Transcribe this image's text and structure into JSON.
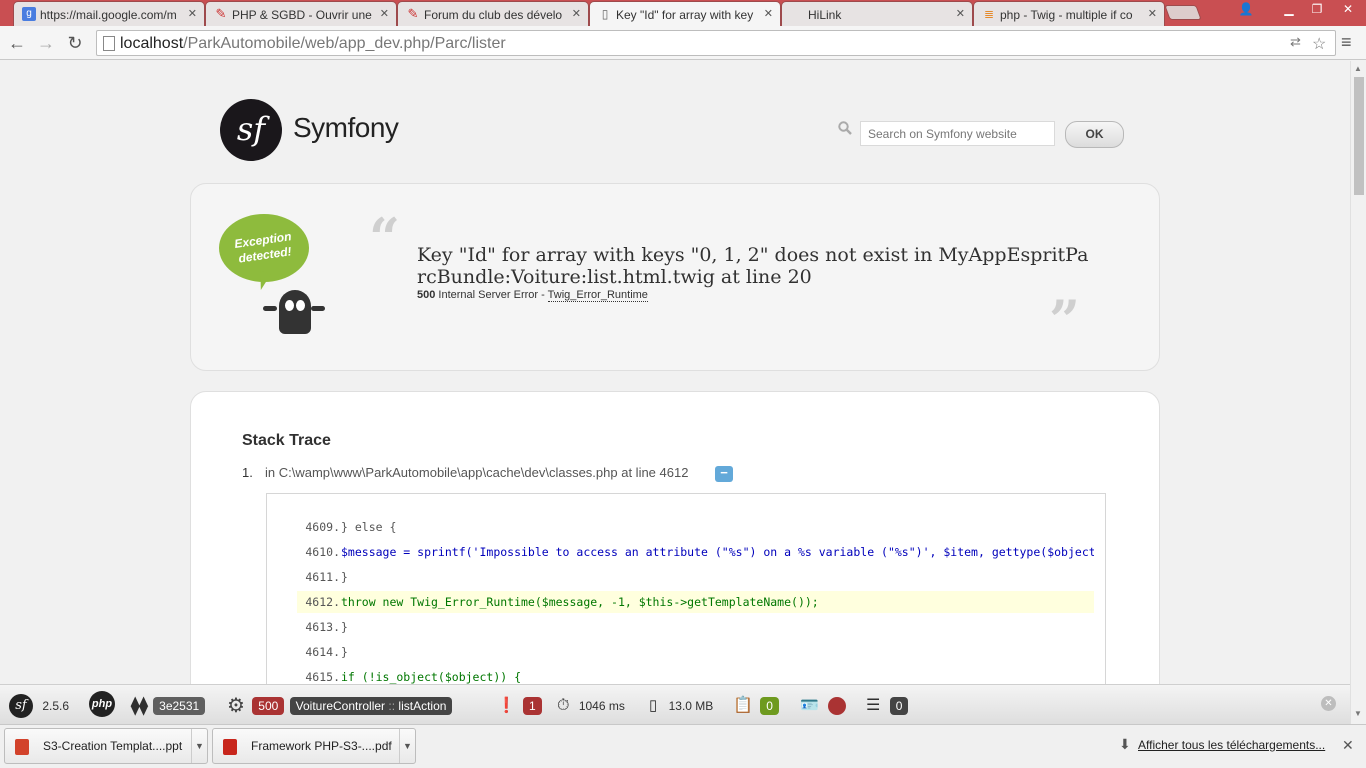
{
  "browser": {
    "tabs": [
      {
        "title": "https://mail.google.com/m",
        "icon": "google-icon",
        "color": "#4a7de0"
      },
      {
        "title": "PHP & SGBD - Ouvrir une",
        "icon": "forum-icon",
        "color": "#c33"
      },
      {
        "title": "Forum du club des dévelo",
        "icon": "forum-icon",
        "color": "#c33"
      },
      {
        "title": "Key \"Id\" for array with key",
        "icon": "page-icon",
        "color": "#888"
      },
      {
        "title": "HiLink",
        "icon": "page-icon",
        "color": "#888"
      },
      {
        "title": "php - Twig - multiple if co",
        "icon": "stackoverflow-icon",
        "color": "#e58a2b"
      }
    ],
    "url_host": "localhost",
    "url_path": "/ParkAutomobile/web/app_dev.php/Parc/lister"
  },
  "header": {
    "brand": "Symfony",
    "logo_text": "sf",
    "search_placeholder": "Search on Symfony website",
    "ok_label": "OK"
  },
  "exception": {
    "badge_text": "Exception detected!",
    "message": "Key \"Id\" for array with keys \"0, 1, 2\" does not exist in MyAppEspritParcBundle:Voiture:list.html.twig at line 20",
    "status_code": "500",
    "status_text": "Internal Server Error -",
    "class_name": "Twig_Error_Runtime"
  },
  "trace": {
    "title": "Stack Trace",
    "item_number": "1.",
    "item_text": "in C:\\wamp\\www\\ParkAutomobile\\app\\cache\\dev\\classes.php at line 4612",
    "toggle": "−",
    "lines": [
      {
        "num": "4609.",
        "code": "} else {"
      },
      {
        "num": "4610.",
        "code": "$message = sprintf('Impossible to access an attribute (\"%s\") on a %s variable (\"%s\")', $item, gettype($object), $obj"
      },
      {
        "num": "4611.",
        "code": "}"
      },
      {
        "num": "4612.",
        "code": "throw new Twig_Error_Runtime($message, -1, $this->getTemplateName());"
      },
      {
        "num": "4613.",
        "code": "}"
      },
      {
        "num": "4614.",
        "code": "}"
      },
      {
        "num": "4615.",
        "code": "if (!is_object($object)) {"
      }
    ]
  },
  "debug_toolbar": {
    "version": "2.5.6",
    "php_label": "php",
    "token": "3e2531",
    "status": "500",
    "controller": "VoitureController",
    "separator": "::",
    "action": "listAction",
    "errors": "1",
    "time": "1046 ms",
    "memory": "13.0 MB",
    "forms": "0",
    "db": "0"
  },
  "downloads": {
    "items": [
      {
        "name": "S3-Creation Templat....ppt",
        "icon": "ppt-icon",
        "color": "#d2422b"
      },
      {
        "name": "Framework PHP-S3-....pdf",
        "icon": "pdf-icon",
        "color": "#c8261c"
      }
    ],
    "show_all": "Afficher tous les téléchargements..."
  }
}
